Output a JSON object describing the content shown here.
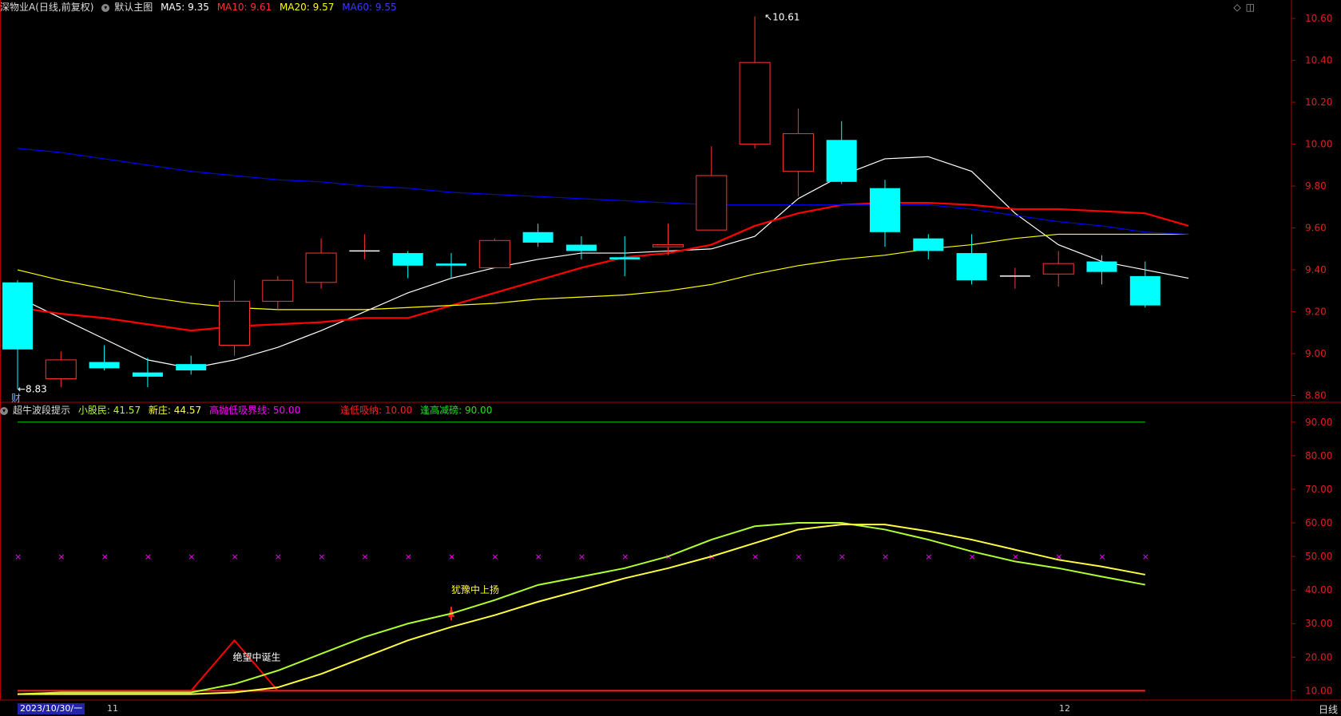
{
  "header": {
    "stock": "深物业A",
    "period": "(日线,前复权)",
    "main_chart": "默认主图",
    "ma5_label": "MA5:",
    "ma5_value": "9.35",
    "ma10_label": "MA10:",
    "ma10_value": "9.61",
    "ma20_label": "MA20:",
    "ma20_value": "9.57",
    "ma60_label": "MA60:",
    "ma60_value": "9.55",
    "fin_marker": "财"
  },
  "indicator_header": {
    "name": "超牛波段提示",
    "small_label": "小股民:",
    "small_value": "41.57",
    "new_label": "新庄:",
    "new_value": "44.57",
    "bound_label": "高抛低吸界线:",
    "bound_value": "50.00",
    "low_label": "逢低吸纳:",
    "low_value": "10.00",
    "high_label": "逢高减磅:",
    "high_value": "90.00"
  },
  "footer": {
    "date": "2023/10/30/一",
    "month1": "11",
    "month2": "12",
    "period_tab": "日线"
  },
  "colors": {
    "up": "#ff3232",
    "down": "#00ffff",
    "ma5": "#ffffff",
    "ma10": "#ff0000",
    "ma20": "#ffff00",
    "ma60": "#0000ff",
    "small": "#adff2f",
    "new": "#ffff40",
    "bound": "#ff00ff",
    "axis": "#b00000"
  },
  "chart_data": [
    {
      "type": "candlestick",
      "y_axis_labels": [
        "10.60",
        "10.40",
        "10.20",
        "10.00",
        "9.80",
        "9.60",
        "9.40",
        "9.20",
        "9.00",
        "8.80"
      ],
      "ylim": [
        8.76,
        10.65
      ],
      "candles": [
        {
          "o": 9.34,
          "c": 9.02,
          "h": 9.35,
          "l": 8.83
        },
        {
          "o": 8.88,
          "c": 8.97,
          "h": 9.01,
          "l": 8.84
        },
        {
          "o": 8.96,
          "c": 8.93,
          "h": 9.04,
          "l": 8.92
        },
        {
          "o": 8.91,
          "c": 8.89,
          "h": 8.98,
          "l": 8.84
        },
        {
          "o": 8.95,
          "c": 8.92,
          "h": 8.99,
          "l": 8.9
        },
        {
          "o": 9.04,
          "c": 9.25,
          "h": 9.35,
          "l": 8.99
        },
        {
          "o": 9.25,
          "c": 9.35,
          "h": 9.37,
          "l": 9.21
        },
        {
          "o": 9.34,
          "c": 9.48,
          "h": 9.55,
          "l": 9.31
        },
        {
          "o": 9.49,
          "c": 9.49,
          "h": 9.57,
          "l": 9.45
        },
        {
          "o": 9.48,
          "c": 9.42,
          "h": 9.49,
          "l": 9.36
        },
        {
          "o": 9.43,
          "c": 9.42,
          "h": 9.48,
          "l": 9.36
        },
        {
          "o": 9.41,
          "c": 9.54,
          "h": 9.55,
          "l": 9.41
        },
        {
          "o": 9.58,
          "c": 9.53,
          "h": 9.62,
          "l": 9.51
        },
        {
          "o": 9.52,
          "c": 9.49,
          "h": 9.56,
          "l": 9.45
        },
        {
          "o": 9.46,
          "c": 9.45,
          "h": 9.56,
          "l": 9.37
        },
        {
          "o": 9.51,
          "c": 9.52,
          "h": 9.62,
          "l": 9.47
        },
        {
          "o": 9.59,
          "c": 9.85,
          "h": 9.99,
          "l": 9.59
        },
        {
          "o": 10.0,
          "c": 10.39,
          "h": 10.61,
          "l": 9.98
        },
        {
          "o": 9.87,
          "c": 10.05,
          "h": 10.17,
          "l": 9.75
        },
        {
          "o": 10.02,
          "c": 9.82,
          "h": 10.11,
          "l": 9.81
        },
        {
          "o": 9.79,
          "c": 9.58,
          "h": 9.83,
          "l": 9.51
        },
        {
          "o": 9.55,
          "c": 9.49,
          "h": 9.57,
          "l": 9.45
        },
        {
          "o": 9.48,
          "c": 9.35,
          "h": 9.57,
          "l": 9.33
        },
        {
          "o": 9.37,
          "c": 9.37,
          "h": 9.41,
          "l": 9.31
        },
        {
          "o": 9.38,
          "c": 9.43,
          "h": 9.49,
          "l": 9.32
        },
        {
          "o": 9.44,
          "c": 9.39,
          "h": 9.47,
          "l": 9.33
        },
        {
          "o": 9.37,
          "c": 9.23,
          "h": 9.44,
          "l": 9.22
        }
      ],
      "series": [
        {
          "name": "MA5",
          "values": [
            9.27,
            9.17,
            9.07,
            8.97,
            8.93,
            8.97,
            9.03,
            9.11,
            9.2,
            9.29,
            9.36,
            9.41,
            9.45,
            9.48,
            9.48,
            9.49,
            9.5,
            9.56,
            9.74,
            9.85,
            9.93,
            9.94,
            9.87,
            9.67,
            9.52,
            9.44,
            9.4,
            9.36
          ]
        },
        {
          "name": "MA10",
          "values": [
            9.22,
            9.19,
            9.17,
            9.14,
            9.11,
            9.13,
            9.14,
            9.15,
            9.17,
            9.17,
            9.23,
            9.29,
            9.35,
            9.41,
            9.46,
            9.48,
            9.52,
            9.61,
            9.67,
            9.71,
            9.72,
            9.72,
            9.71,
            9.69,
            9.69,
            9.68,
            9.67,
            9.61
          ]
        },
        {
          "name": "MA20",
          "values": [
            9.4,
            9.35,
            9.31,
            9.27,
            9.24,
            9.22,
            9.21,
            9.21,
            9.21,
            9.22,
            9.23,
            9.24,
            9.26,
            9.27,
            9.28,
            9.3,
            9.33,
            9.38,
            9.42,
            9.45,
            9.47,
            9.5,
            9.52,
            9.55,
            9.57,
            9.57,
            9.57,
            9.57
          ]
        },
        {
          "name": "MA60",
          "values": [
            9.98,
            9.96,
            9.93,
            9.9,
            9.87,
            9.85,
            9.83,
            9.82,
            9.8,
            9.79,
            9.77,
            9.76,
            9.75,
            9.74,
            9.73,
            9.72,
            9.71,
            9.71,
            9.71,
            9.71,
            9.71,
            9.71,
            9.69,
            9.66,
            9.63,
            9.61,
            9.58,
            9.57
          ]
        }
      ],
      "annotations": {
        "high": "10.61",
        "low": "8.83"
      }
    },
    {
      "type": "line",
      "y_axis_labels": [
        "90.00",
        "80.00",
        "70.00",
        "60.00",
        "50.00",
        "40.00",
        "30.00",
        "20.00",
        "10.00"
      ],
      "ylim": [
        7,
        94
      ],
      "series": [
        {
          "name": "小股民",
          "values": [
            9,
            9.5,
            9.5,
            9.5,
            9.5,
            12,
            16,
            21,
            26,
            30,
            33,
            37,
            41.5,
            44,
            46.5,
            50,
            55,
            59,
            60,
            60,
            58,
            55,
            51.5,
            48.5,
            46.5,
            44,
            41.57
          ]
        },
        {
          "name": "新庄",
          "values": [
            9,
            9,
            9,
            9,
            9,
            9.5,
            11,
            15,
            20,
            25,
            29,
            32.5,
            36.5,
            40,
            43.5,
            46.5,
            50,
            54,
            58,
            59.5,
            59.5,
            57.5,
            55,
            52,
            49,
            47,
            44.57
          ]
        },
        {
          "name": "高抛低吸界线",
          "value": 50
        },
        {
          "name": "逢低吸纳",
          "value": 10
        },
        {
          "name": "逢高减磅",
          "value": 90
        }
      ],
      "annotations": [
        {
          "text": "绝望中诞生",
          "index": 5
        },
        {
          "text": "犹豫中上扬",
          "index": 10
        }
      ]
    }
  ]
}
